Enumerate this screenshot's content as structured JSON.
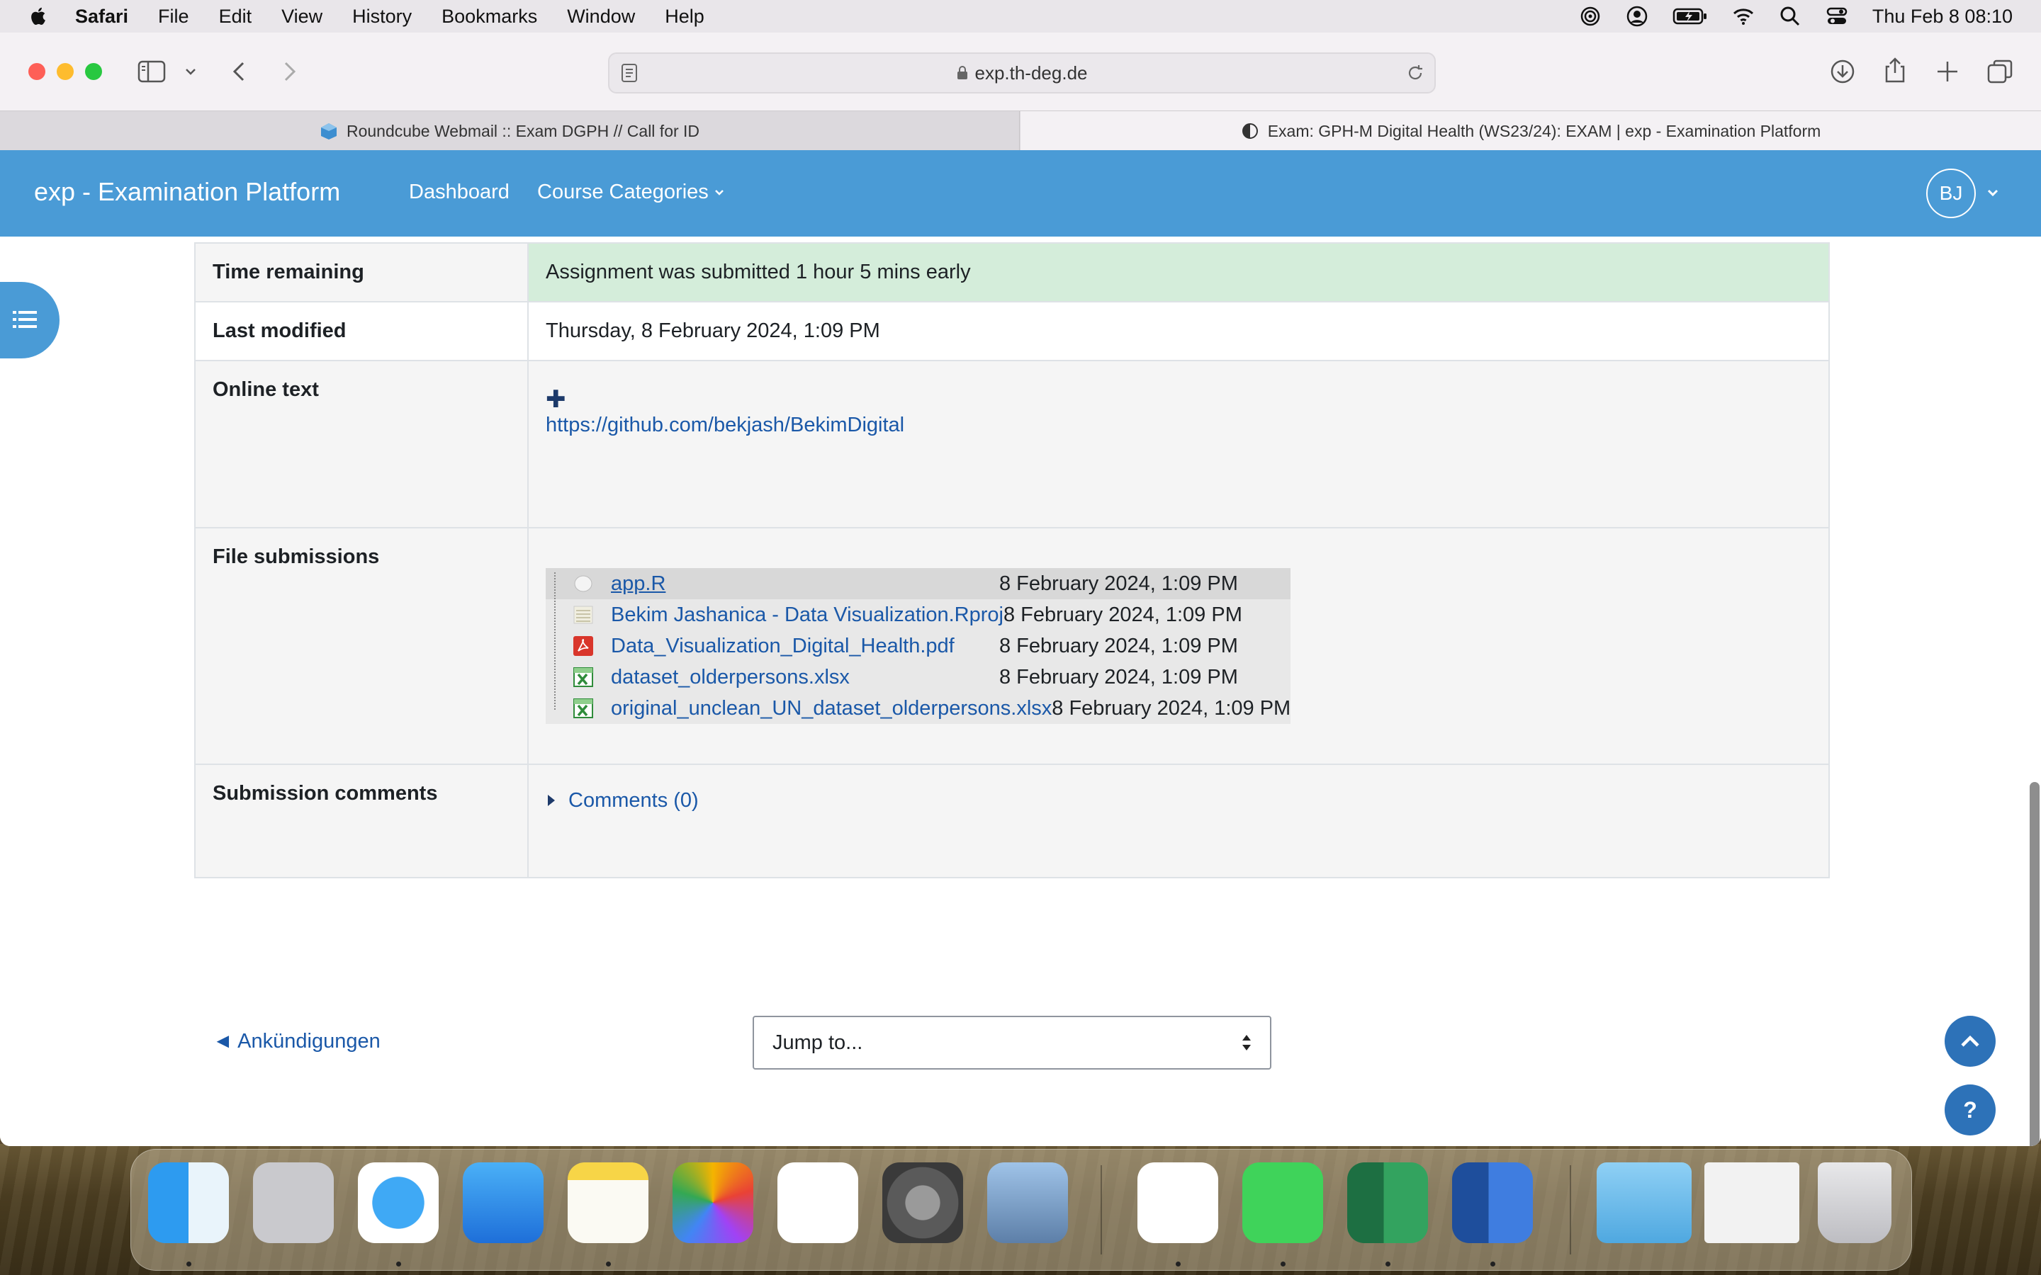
{
  "menubar": {
    "app": "Safari",
    "items": [
      "File",
      "Edit",
      "View",
      "History",
      "Bookmarks",
      "Window",
      "Help"
    ],
    "clock": "Thu Feb 8  08:10"
  },
  "browser": {
    "url": "exp.th-deg.de",
    "tabs": [
      {
        "title": "Roundcube Webmail :: Exam DGPH // Call for ID",
        "active": false
      },
      {
        "title": "Exam: GPH-M Digital Health (WS23/24): EXAM | exp - Examination Platform",
        "active": true
      }
    ]
  },
  "navbar": {
    "brand": "exp - Examination Platform",
    "links": [
      "Dashboard",
      "Course Categories"
    ],
    "avatar_initials": "BJ"
  },
  "submission": {
    "time_remaining": {
      "label": "Time remaining",
      "value": "Assignment was submitted 1 hour 5 mins early"
    },
    "last_modified": {
      "label": "Last modified",
      "value": "Thursday, 8 February 2024, 1:09 PM"
    },
    "online_text": {
      "label": "Online text",
      "expand_symbol": "✚",
      "value": "https://github.com/bekjash/BekimDigital"
    },
    "file_submissions": {
      "label": "File submissions",
      "files": [
        {
          "name": "app.R",
          "date": "8 February 2024, 1:09 PM",
          "icon": "generic-file-icon"
        },
        {
          "name": "Bekim Jashanica - Data Visualization.Rproj",
          "date": "8 February 2024, 1:09 PM",
          "icon": "text-file-icon"
        },
        {
          "name": "Data_Visualization_Digital_Health.pdf",
          "date": "8 February 2024, 1:09 PM",
          "icon": "pdf-icon"
        },
        {
          "name": "dataset_olderpersons.xlsx",
          "date": "8 February 2024, 1:09 PM",
          "icon": "spreadsheet-icon"
        },
        {
          "name": "original_unclean_UN_dataset_olderpersons.xlsx",
          "date": "8 February 2024, 1:09 PM",
          "icon": "spreadsheet-icon"
        }
      ]
    },
    "comments": {
      "label": "Submission comments",
      "link": "Comments (0)"
    }
  },
  "footer": {
    "prev_link": "◄ Ankündigungen",
    "jump_placeholder": "Jump to...",
    "help_symbol": "?"
  },
  "colors": {
    "brand_blue": "#4a9bd6",
    "link_blue": "#1a58a8",
    "success_green": "#d4edda"
  }
}
